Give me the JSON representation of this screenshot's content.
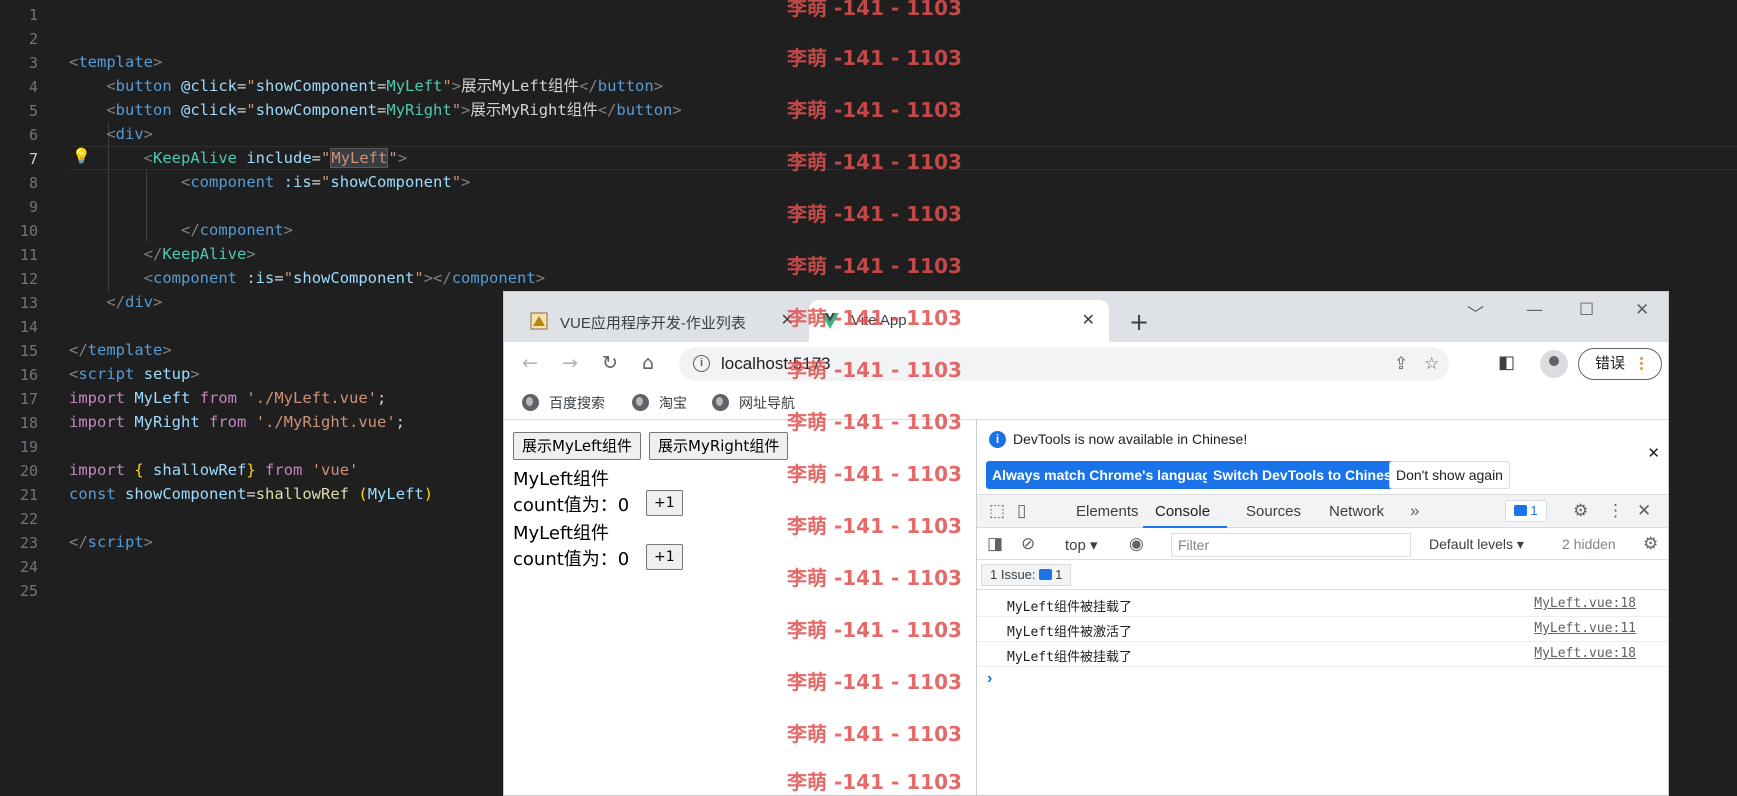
{
  "editor": {
    "line_numbers": [
      "1",
      "2",
      "3",
      "4",
      "5",
      "6",
      "7",
      "8",
      "9",
      "10",
      "11",
      "12",
      "13",
      "14",
      "15",
      "16",
      "17",
      "18",
      "19",
      "20",
      "21",
      "22",
      "23",
      "24",
      "25"
    ],
    "active_line": "7"
  },
  "browser": {
    "tabs": [
      {
        "title": "VUE应用程序开发-作业列表",
        "close": "✕"
      },
      {
        "title": "Vite App",
        "close": "✕"
      }
    ],
    "new_tab": "+",
    "url": "localhost:5173",
    "error_button": "错误",
    "bookmarks": [
      "百度搜索",
      "淘宝",
      "网址导航"
    ]
  },
  "page": {
    "btn_left": "展示MyLeft组件",
    "btn_right": "展示MyRight组件",
    "comp1_title": "MyLeft组件",
    "comp1_count_label": "count值为：",
    "comp1_count_value": "0",
    "comp1_inc": "+1",
    "comp2_title": "MyLeft组件",
    "comp2_count_label": "count值为：",
    "comp2_count_value": "0",
    "comp2_inc": "+1"
  },
  "devtools": {
    "info_message": "DevTools is now available in Chinese!",
    "btn_match": "Always match Chrome's language",
    "btn_switch": "Switch DevTools to Chinese",
    "btn_dont": "Don't show again",
    "tabs": [
      "Elements",
      "Console",
      "Sources",
      "Network"
    ],
    "active_tab": "Console",
    "issue_count": "1",
    "context": "top",
    "filter_placeholder": "Filter",
    "levels": "Default levels",
    "hidden": "2 hidden",
    "issues_label": "1 Issue:",
    "issues_count": "1",
    "logs": [
      {
        "message": "MyLeft组件被挂载了",
        "source": "MyLeft.vue:18"
      },
      {
        "message": "MyLeft组件被激活了",
        "source": "MyLeft.vue:11"
      },
      {
        "message": "MyLeft组件被挂载了",
        "source": "MyLeft.vue:18"
      }
    ]
  },
  "watermark": {
    "text": "李萌 -141 - 1103"
  },
  "colors": {
    "editor_bg": "#1f1f1f",
    "tag_blue": "#569cd6",
    "component_teal": "#4ec9b0",
    "string": "#ce9178",
    "keyword": "#c586c0",
    "chrome_blue": "#1a73e8",
    "watermark_red": "#e05050"
  }
}
